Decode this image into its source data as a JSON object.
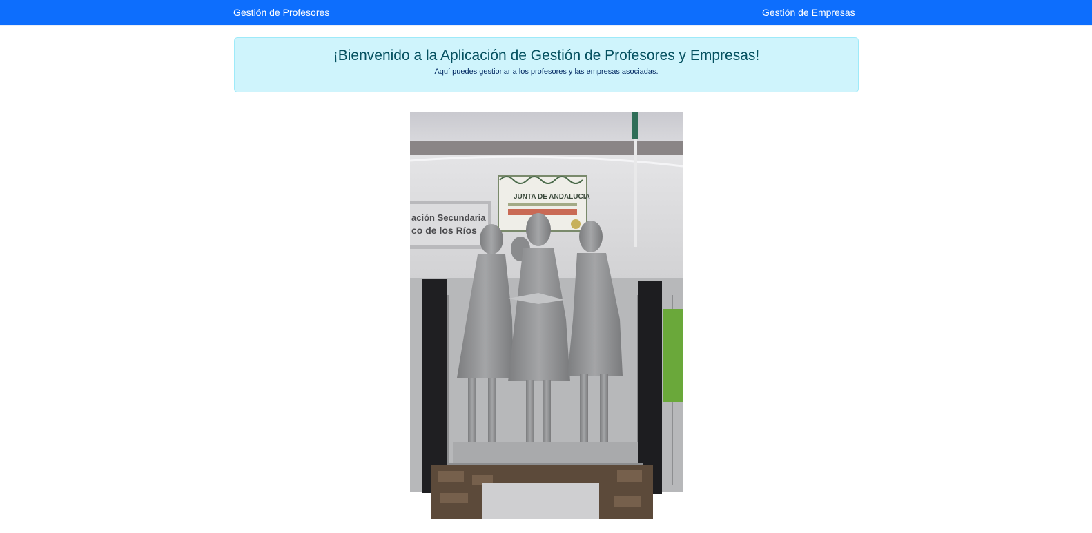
{
  "navbar": {
    "left_link": "Gestión de Profesores",
    "right_link": "Gestión de Empresas"
  },
  "welcome": {
    "title": "¡Bienvenido a la Aplicación de Gestión de Profesores y Empresas!",
    "subtitle": "Aquí puedes gestionar a los profesores y las empresas asociadas."
  },
  "photo": {
    "plaque_line1": "JUNTA DE ANDALUCIA",
    "sign_line1": "ación Secundaria",
    "sign_line2": "co de los Ríos"
  },
  "colors": {
    "navbar_bg": "#0d6efd",
    "alert_bg": "#cff4fc",
    "alert_border": "#9eeaf9",
    "alert_text": "#055160"
  }
}
